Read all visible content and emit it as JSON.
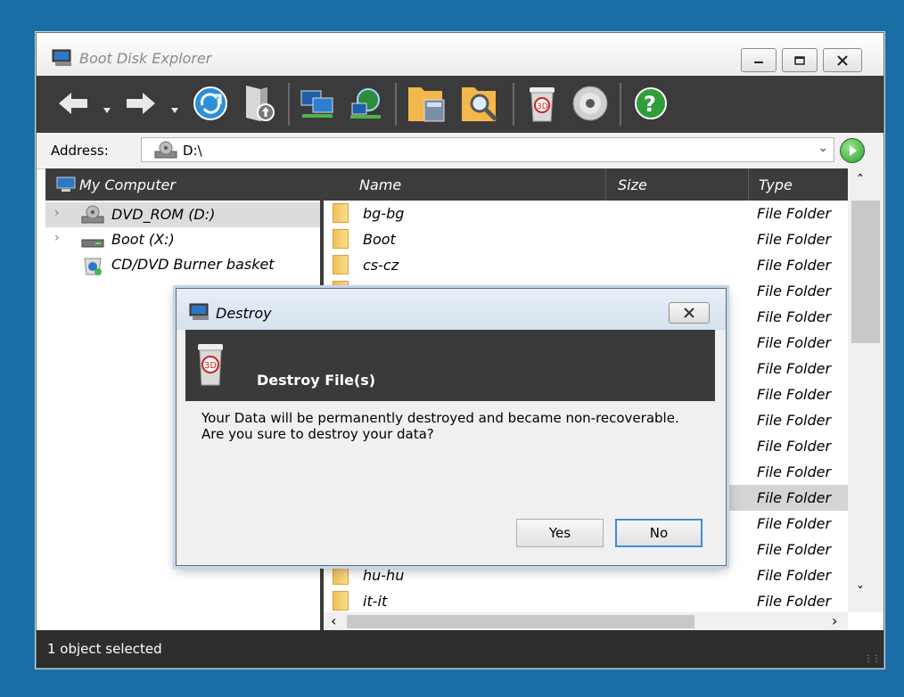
{
  "window": {
    "title": "Boot Disk Explorer"
  },
  "toolbar": {
    "buttons": [
      "back-icon",
      "forward-icon",
      "refresh-icon",
      "up-folder-icon",
      "network-computers-icon",
      "network-globe-icon",
      "folder-calculator-icon",
      "folder-search-icon",
      "destroy-bin-icon",
      "disc-icon",
      "help-icon"
    ]
  },
  "address": {
    "label": "Address:",
    "value": "D:\\"
  },
  "left_pane": {
    "header": "My Computer",
    "items": [
      {
        "label": "DVD_ROM (D:)",
        "icon": "dvd-drive-icon",
        "selected": true,
        "expandable": true
      },
      {
        "label": "Boot (X:)",
        "icon": "drive-icon",
        "selected": false,
        "expandable": true
      },
      {
        "label": "CD/DVD Burner basket",
        "icon": "burner-basket-icon",
        "selected": false,
        "expandable": false
      }
    ]
  },
  "file_list": {
    "columns": [
      "Name",
      "Size",
      "Type"
    ],
    "rows": [
      {
        "name": "bg-bg",
        "type": "File Folder"
      },
      {
        "name": "Boot",
        "type": "File Folder"
      },
      {
        "name": "cs-cz",
        "type": "File Folder"
      },
      {
        "name": "",
        "type": "File Folder"
      },
      {
        "name": "",
        "type": "File Folder"
      },
      {
        "name": "",
        "type": "File Folder"
      },
      {
        "name": "",
        "type": "File Folder"
      },
      {
        "name": "",
        "type": "File Folder"
      },
      {
        "name": "",
        "type": "File Folder"
      },
      {
        "name": "",
        "type": "File Folder"
      },
      {
        "name": "",
        "type": "File Folder"
      },
      {
        "name": "",
        "type": "File Folder",
        "highlighted": true
      },
      {
        "name": "",
        "type": "File Folder"
      },
      {
        "name": "",
        "type": "File Folder"
      },
      {
        "name": "hu-hu",
        "type": "File Folder"
      },
      {
        "name": "it-it",
        "type": "File Folder"
      }
    ]
  },
  "status": {
    "text": "1 object selected"
  },
  "dialog": {
    "title": "Destroy",
    "heading": "Destroy File(s)",
    "message_line1": "Your Data will be permanently destroyed and became non-recoverable.",
    "message_line2": "Are you sure to destroy your data?",
    "yes_label": "Yes",
    "no_label": "No"
  }
}
